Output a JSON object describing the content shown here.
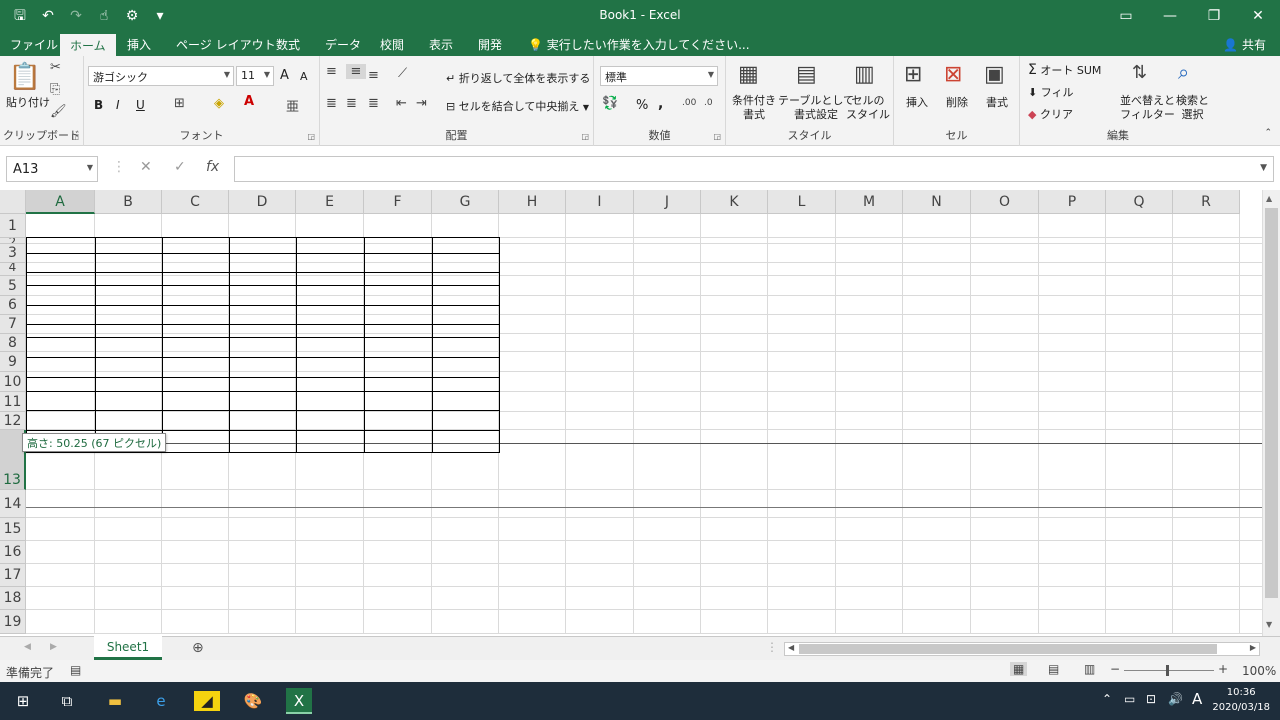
{
  "window": {
    "title": "Book1 - Excel"
  },
  "qat": {
    "save_icon": "save-icon",
    "undo_icon": "undo-icon",
    "redo_icon": "redo-icon",
    "customize": "▾"
  },
  "tabs": [
    "ファイル",
    "ホーム",
    "挿入",
    "ページ レイアウト",
    "数式",
    "データ",
    "校閲",
    "表示",
    "開発"
  ],
  "tell_me": "実行したい作業を入力してください...",
  "share": "共有",
  "ribbon": {
    "clipboard": {
      "label": "クリップボード",
      "paste": "貼り付け"
    },
    "font": {
      "label": "フォント",
      "name": "游ゴシック",
      "size": "11",
      "bold": "B",
      "italic": "I",
      "underline": "U",
      "grow": "A",
      "shrink": "A"
    },
    "alignment": {
      "label": "配置",
      "wrap": "折り返して全体を表示する",
      "merge": "セルを結合して中央揃え"
    },
    "number": {
      "label": "数値",
      "format": "標準",
      "percent": "%",
      "comma": ","
    },
    "styles": {
      "label": "スタイル",
      "conditional": [
        "条件付き",
        "書式"
      ],
      "as_table": [
        "テーブルとして",
        "書式設定"
      ],
      "cell_styles": [
        "セルの",
        "スタイル"
      ]
    },
    "cells": {
      "label": "セル",
      "insert": "挿入",
      "delete": "削除",
      "format": "書式"
    },
    "editing": {
      "label": "編集",
      "autosum": "オート SUM",
      "fill": "フィル",
      "clear": "クリア",
      "sort": [
        "並べ替えと",
        "フィルター"
      ],
      "find": [
        "検索と",
        "選択"
      ]
    }
  },
  "formula_bar": {
    "name_box": "A13",
    "cancel": "✕",
    "enter": "✓",
    "fx": "fx",
    "value": ""
  },
  "columns": [
    "A",
    "B",
    "C",
    "D",
    "E",
    "F",
    "G",
    "H",
    "I",
    "J",
    "K",
    "L",
    "M",
    "N",
    "O",
    "P",
    "Q",
    "R"
  ],
  "rows": [
    "1",
    "2",
    "3",
    "4",
    "5",
    "6",
    "7",
    "8",
    "9",
    "10",
    "11",
    "12",
    "13",
    "14",
    "15",
    "16",
    "17",
    "18",
    "19"
  ],
  "selected": {
    "column": "A",
    "row": "13"
  },
  "tooltip": "高さ: 50.25 (67 ピクセル)",
  "sheet_tab": "Sheet1",
  "status": {
    "ready": "準備完了",
    "zoom": "100%"
  },
  "taskbar": {
    "time": "10:36",
    "date": "2020/03/18",
    "ime": "A"
  },
  "colors": {
    "accent": "#217346",
    "taskbar": "#1e2d3b"
  }
}
